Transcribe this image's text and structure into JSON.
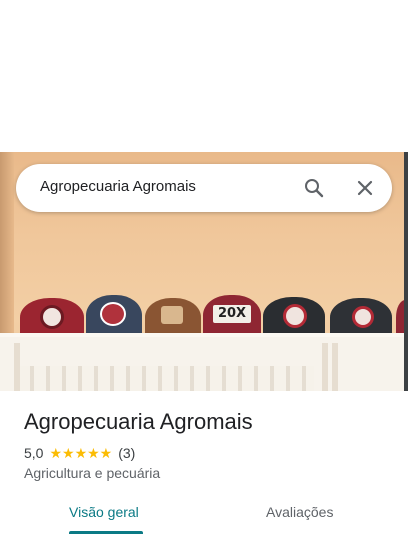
{
  "search": {
    "query": "Agropecuaria Agromais",
    "icons": [
      "search-icon",
      "close-icon"
    ]
  },
  "place": {
    "name": "Agropecuaria Agromais",
    "rating": "5,0",
    "stars": "★★★★★",
    "review_count": "(3)",
    "category": "Agricultura e pecuária",
    "hero_logo_text": "20X"
  },
  "tabs": [
    {
      "label": "Visão geral",
      "selected": true
    },
    {
      "label": "Avaliações",
      "selected": false
    }
  ],
  "colors": {
    "accent": "#0b7a85",
    "star": "#fbbc04",
    "text_primary": "#202124",
    "text_secondary": "#5f6368"
  }
}
